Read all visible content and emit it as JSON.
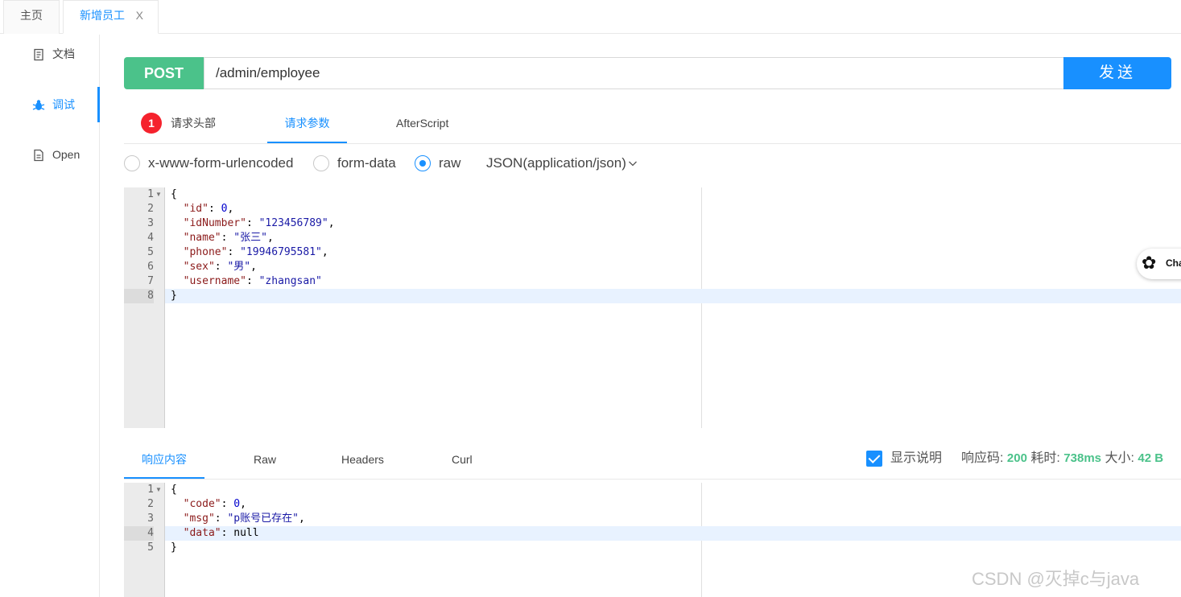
{
  "tabs": {
    "home": "主页",
    "active": "新增员工",
    "close": "X"
  },
  "sidebar": {
    "items": [
      {
        "icon": "document-icon",
        "label": "文档"
      },
      {
        "icon": "bug-icon",
        "label": "调试"
      },
      {
        "icon": "file-icon",
        "label": "Open"
      }
    ]
  },
  "request": {
    "method": "POST",
    "url": "/admin/employee",
    "send": "发送"
  },
  "request_tabs": {
    "headers_badge": "1",
    "headers": "请求头部",
    "params": "请求参数",
    "after_script": "AfterScript"
  },
  "body_types": {
    "urlencoded": "x-www-form-urlencoded",
    "form_data": "form-data",
    "raw": "raw",
    "content_type": "JSON(application/json)",
    "selected": "raw"
  },
  "request_body": {
    "line_numbers": [
      "1",
      "2",
      "3",
      "4",
      "5",
      "6",
      "7",
      "8"
    ],
    "active_line": "8",
    "open_brace": "{",
    "close_brace": "}",
    "fields": [
      {
        "key": "\"id\"",
        "value": "0",
        "type": "number",
        "comma": ","
      },
      {
        "key": "\"idNumber\"",
        "value": "\"123456789\"",
        "type": "string",
        "comma": ","
      },
      {
        "key": "\"name\"",
        "value": "\"张三\"",
        "type": "string",
        "comma": ","
      },
      {
        "key": "\"phone\"",
        "value": "\"19946795581\"",
        "type": "string",
        "comma": ","
      },
      {
        "key": "\"sex\"",
        "value": "\"男\"",
        "type": "string",
        "comma": ","
      },
      {
        "key": "\"username\"",
        "value": "\"zhangsan\"",
        "type": "string",
        "comma": ""
      }
    ]
  },
  "response_tabs": {
    "content": "响应内容",
    "raw": "Raw",
    "headers": "Headers",
    "curl": "Curl"
  },
  "response_meta": {
    "show_desc": "显示说明",
    "status_label": "响应码:",
    "status": "200",
    "time_label": "耗时:",
    "time": "738ms",
    "size_label": "大小:",
    "size": "42 B"
  },
  "response_body": {
    "line_numbers": [
      "1",
      "2",
      "3",
      "4",
      "5"
    ],
    "active_line": "4",
    "open_brace": "{",
    "close_brace": "}",
    "fields": [
      {
        "key": "\"code\"",
        "value": "0",
        "type": "number",
        "comma": ","
      },
      {
        "key": "\"msg\"",
        "value": "\"p账号已存在\"",
        "type": "string",
        "comma": ","
      },
      {
        "key": "\"data\"",
        "value": "null",
        "type": "null",
        "comma": ""
      }
    ]
  },
  "chat_button": "Cha",
  "watermark": "CSDN @灭掉c与java",
  "colors": {
    "accent": "#1890ff",
    "post": "#4bc28a",
    "badge": "#f5222d"
  }
}
